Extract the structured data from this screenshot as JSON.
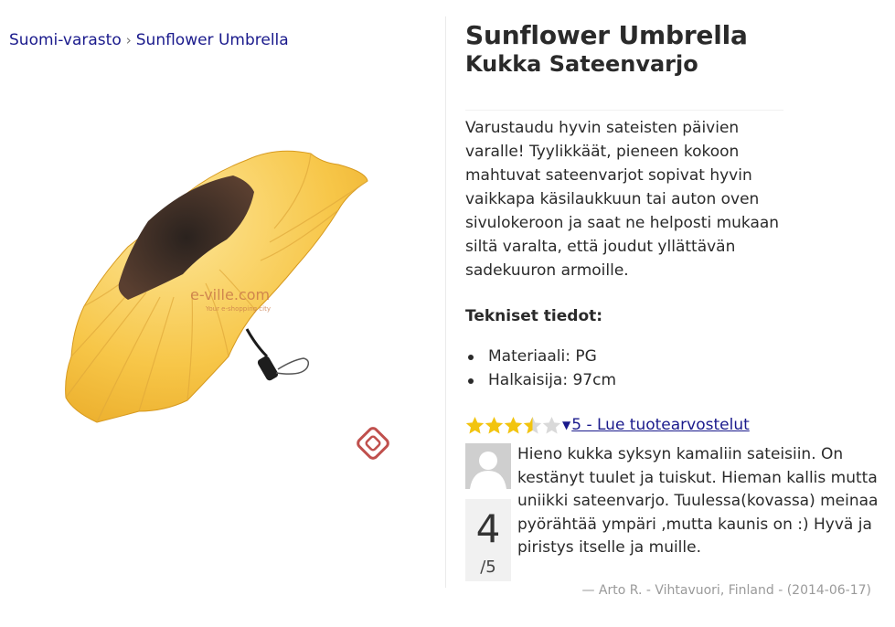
{
  "breadcrumb": {
    "home": "Suomi-varasto",
    "separator": "›",
    "current": "Sunflower Umbrella"
  },
  "product": {
    "title": "Sunflower Umbrella",
    "subtitle": "Kukka Sateenvarjo",
    "description": "Varustaudu hyvin sateisten päivien varalle! Tyylikkäät, pieneen kokoon mahtuvat sateenvarjot sopivat hyvin vaikkapa käsilaukkuun tai auton oven sivulokeroon ja saat ne helposti mukaan siltä varalta, että joudut yllättävän sadekuuron armoille.",
    "image_icon": "sunflower-umbrella-photo",
    "watermark": "e-ville.com",
    "watermark_tagline": "Your e-shopping city"
  },
  "specs": {
    "heading": "Tekniset tiedot:",
    "items": [
      "Materiaali: PG",
      "Halkaisija: 97cm"
    ]
  },
  "rating": {
    "stars": 3.5,
    "max": 5,
    "caret_icon": "caret-down-icon",
    "link_text": "5 - Lue tuotearvostelut",
    "star_color": "#f2c40f",
    "star_empty_color": "#d9d9d9"
  },
  "review": {
    "avatar_icon": "avatar-placeholder-icon",
    "score": "4",
    "score_max": "/5",
    "text": "Hieno kukka syksyn kamaliin sateisiin. On kestänyt tuulet ja tuiskut. Hieman kallis mutta uniikki sateenvarjo. Tuulessa(kovassa) meinaa pyörähtää ympäri ,mutta kaunis on :) Hyvä ja piristys itselle ja muille.",
    "author": "— Arto R. - Vihtavuori, Finland - (2014-06-17)"
  },
  "colors": {
    "link": "#1a1a8c",
    "meta": "#9a9a9a",
    "petal": "#f6c23e",
    "logo": "#c0504d"
  }
}
